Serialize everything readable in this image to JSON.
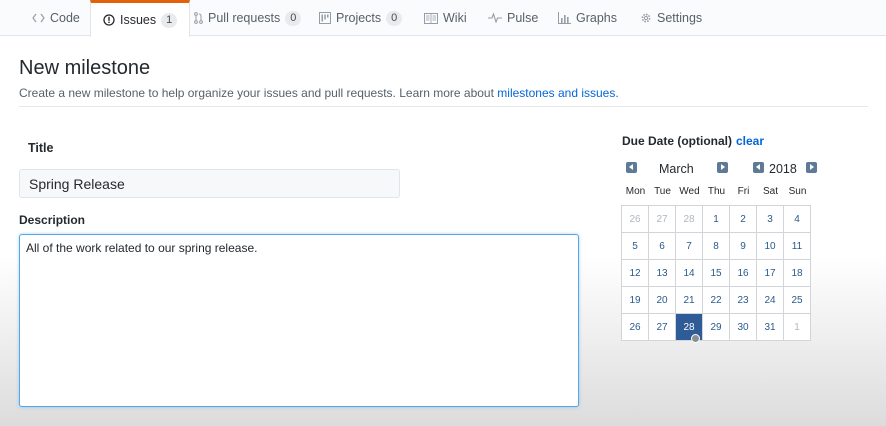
{
  "tabs": [
    {
      "label": "Code",
      "icon": "code-icon",
      "counter": ""
    },
    {
      "label": "Issues",
      "icon": "issue-opened-icon",
      "counter": "1"
    },
    {
      "label": "Pull requests",
      "icon": "git-pull-request-icon",
      "counter": "0"
    },
    {
      "label": "Projects",
      "icon": "project-icon",
      "counter": "0"
    },
    {
      "label": "Wiki",
      "icon": "book-icon",
      "counter": ""
    },
    {
      "label": "Pulse",
      "icon": "pulse-icon",
      "counter": ""
    },
    {
      "label": "Graphs",
      "icon": "graph-icon",
      "counter": ""
    },
    {
      "label": "Settings",
      "icon": "gear-icon",
      "counter": ""
    }
  ],
  "selected_tab": "Issues",
  "header": {
    "title": "New milestone",
    "subtitle": "Create a new milestone to help organize your issues and pull requests. Learn more about",
    "link": "milestones and issues."
  },
  "form": {
    "title_label": "Title",
    "title_value": "Spring Release",
    "description_label": "Description",
    "description_value": "All of the work related to our spring release."
  },
  "due_date": {
    "label": "Due Date (optional)",
    "clear_label": "clear",
    "month": "March",
    "year": "2018",
    "weekdays": [
      "Mon",
      "Tue",
      "Wed",
      "Thu",
      "Fri",
      "Sat",
      "Sun"
    ],
    "weeks": [
      [
        "26",
        "27",
        "28",
        "1",
        "2",
        "3",
        "4"
      ],
      [
        "5",
        "6",
        "7",
        "8",
        "9",
        "10",
        "11"
      ],
      [
        "12",
        "13",
        "14",
        "15",
        "16",
        "17",
        "18"
      ],
      [
        "19",
        "20",
        "21",
        "22",
        "23",
        "24",
        "25"
      ],
      [
        "26",
        "27",
        "28",
        "29",
        "30",
        "31",
        "1"
      ]
    ],
    "selected_day": "28"
  },
  "colors": {
    "tab_accent": "#e36209",
    "link": "#0366d6",
    "selected_day": "#2f5c97",
    "focus_border": "#51a7e8"
  }
}
